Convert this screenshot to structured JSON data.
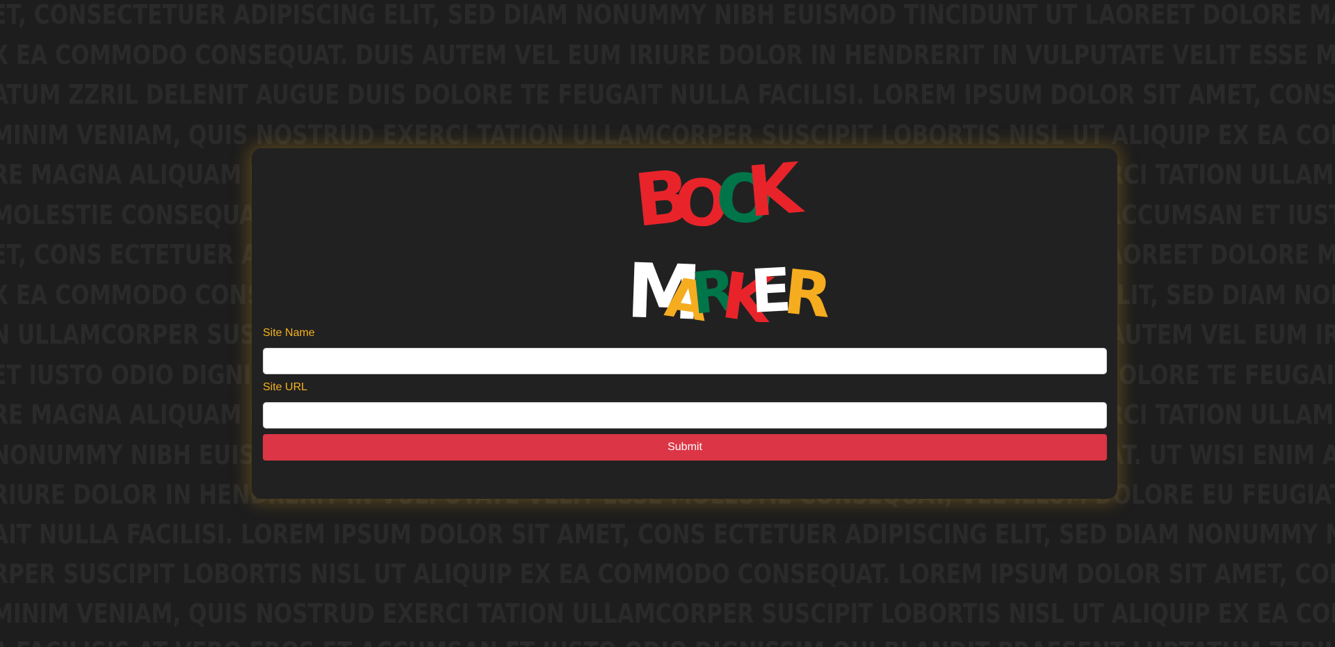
{
  "background": {
    "lines": [
      "ET, CONSECTETUER ADIPISCING ELIT, SED DIAM NONUMMY NIBH EUISMOD TINCIDUNT UT LAOREET DOLORE MAGNA",
      "X EA COMMODO CONSEQUAT. DUIS AUTEM VEL EUM IRIURE DOLOR IN HENDRERIT IN VULPUTATE VELIT ESSE MOLESTIE",
      "ATUM ZZRIL DELENIT AUGUE DUIS DOLORE TE FEUGAIT NULLA FACILISI. LOREM IPSUM DOLOR SIT AMET, CONS",
      "MINIM VENIAM, QUIS NOSTRUD EXERCI TATION ULLAMCORPER SUSCIPIT LOBORTIS NISL UT ALIQUIP EX EA COMMODO",
      "RE MAGNA ALIQUAM ERAT VOLUTPAT. UT WISI ENIM AD MINIM VENIAM, QUIS NOSTRUD EXERCI TATION ULLAMCORPER",
      "MOLESTIE CONSEQUAT, VEL ILLUM DOLORE EU FEUGIAT NULLA FACILISIS AT VERO EROS ET ACCUMSAN ET IUSTO",
      "ET, CONS ECTETUER ADIPISCING ELIT, SED DIAM NONUMMY NIBH EUISMOD TINCIDUNT UT LAOREET DOLORE MAGNA",
      "X EA COMMODO CONSEQUAT. LOREM IPSUM DOLOR SIT AMET, CONSECTETUER ADIPISCING ELIT, SED DIAM NONUMMY",
      "N ULLAMCORPER SUSCIPIT LOBORTIS NISL UT ALIQUIP EX EA COMMODO CONSEQUAT. DUIS AUTEM VEL EUM IRIURE",
      "ET IUSTO ODIO DIGNISSIM QUI BLANDIT PRAESENT LUPTATUM ZZRIL DELENIT AUGUE DUIS DOLORE TE FEUGAIT",
      "RE MAGNA ALIQUAM ERAT VOLUTPAT. UT WISI ENIM AD MINIM VENIAM, QUIS NOSTRUD EXERCI TATION ULLAMCORPER",
      "NONUMMY NIBH EUISMOD TINCIDUNT UT LAOREET DOLORE MAGNA ALIQUAM ERAT VOLUTPAT. UT WISI ENIM AD MINIM",
      "RIURE DOLOR IN HENDRERIT IN VULPUTATE VELIT ESSE MOLESTIE CONSEQUAT, VEL ILLUM DOLORE EU FEUGIAT NULLA",
      "AIT NULLA FACILISI. LOREM IPSUM DOLOR SIT AMET, CONS ECTETUER ADIPISCING ELIT, SED DIAM NONUMMY NIBH",
      "RPER SUSCIPIT LOBORTIS NISL UT ALIQUIP EX EA COMMODO CONSEQUAT. LOREM IPSUM DOLOR SIT AMET, CONSECTETUER",
      "MINIM VENIAM, QUIS NOSTRUD EXERCI TATION ULLAMCORPER SUSCIPIT LOBORTIS NISL UT ALIQUIP EX EA COMMODO",
      "A FACILISIS AT VERO EROS ET ACCUMSAN ET IUSTO ODIO DIGNISSIM QUI BLANDIT PRAESENT LUPTATUM ZZRIL DELENIT"
    ]
  },
  "logo": {
    "word1": [
      {
        "letter": "B",
        "color": "#e8242a"
      },
      {
        "letter": "O",
        "color": "#e8242a"
      },
      {
        "letter": "O",
        "color": "#00754a"
      },
      {
        "letter": "K",
        "color": "#e8242a"
      }
    ],
    "word2": [
      {
        "letter": "M",
        "color": "#ffffff"
      },
      {
        "letter": "A",
        "color": "#f5ac1e"
      },
      {
        "letter": "R",
        "color": "#00754a"
      },
      {
        "letter": "K",
        "color": "#e8242a"
      },
      {
        "letter": "E",
        "color": "#ffffff"
      },
      {
        "letter": "R",
        "color": "#f5ac1e"
      }
    ]
  },
  "form": {
    "site_name_label": "Site Name",
    "site_name_value": "",
    "site_url_label": "Site URL",
    "site_url_value": "",
    "submit_label": "Submit"
  },
  "colors": {
    "accent_label": "#f5b21e",
    "submit_bg": "#dc3545",
    "card_bg": "#212121",
    "page_bg": "#1d1d1d"
  }
}
